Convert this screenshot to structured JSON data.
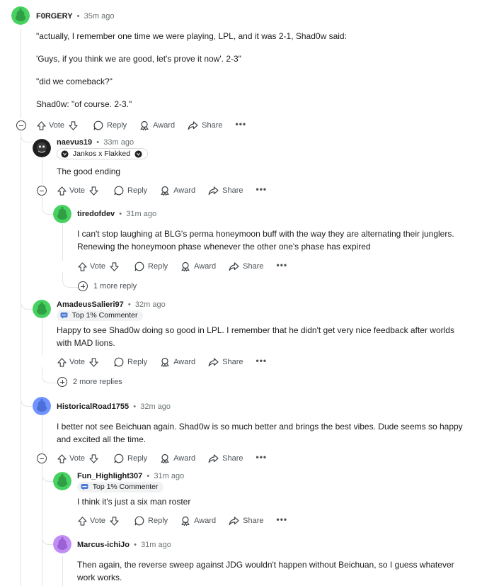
{
  "colors": {
    "avatar_green": "#46d160",
    "avatar_blue": "#7193ff",
    "avatar_purple": "#c18df5",
    "thread_line": "#e1e4e6",
    "meta_gray": "#6b7275"
  },
  "actions": {
    "vote": "Vote",
    "reply": "Reply",
    "award": "Award",
    "share": "Share",
    "more": "•••"
  },
  "comments": [
    {
      "user": "F0RGERY",
      "time": "35m ago",
      "avatar_color": "green",
      "paragraphs": [
        "\"actually, I remember one time we were playing, LPL, and it was 2-1, Shad0w said:",
        "'Guys, if you think we are good, let's prove it now'. 2-3\"",
        "\"did we comeback?\"",
        "Shad0w: \"of course. 2-3.\""
      ]
    },
    {
      "user": "naevus19",
      "time": "33m ago",
      "avatar_color": "dark",
      "flair": "Jankos x Flakked",
      "flair_icon": "team-logo-icon",
      "paragraphs": [
        "The good ending"
      ]
    },
    {
      "user": "tiredofdev",
      "time": "31m ago",
      "avatar_color": "green",
      "paragraphs": [
        "I can't stop laughing at BLG's perma honeymoon buff with the way they are alternating their junglers. Renewing the honeymoon phase whenever the other one's phase has expired"
      ],
      "more_replies": "1 more reply"
    },
    {
      "user": "AmadeusSalieri97",
      "time": "32m ago",
      "avatar_color": "green",
      "flair": "Top 1% Commenter",
      "flair_icon": "top-commenter-icon",
      "paragraphs": [
        "Happy to see Shad0w doing so good in LPL. I remember that he didn't get very nice feedback after worlds with MAD lions."
      ],
      "more_replies": "2 more replies"
    },
    {
      "user": "HistoricalRoad1755",
      "time": "32m ago",
      "avatar_color": "blue",
      "paragraphs": [
        "I better not see Beichuan again. Shad0w is so much better and brings the best vibes. Dude seems so happy and excited all the time."
      ]
    },
    {
      "user": "Fun_Highlight307",
      "time": "31m ago",
      "avatar_color": "green",
      "flair": "Top 1% Commenter",
      "flair_icon": "top-commenter-icon",
      "paragraphs": [
        "I think it's just a six man roster"
      ]
    },
    {
      "user": "Marcus-ichiJo",
      "time": "31m ago",
      "avatar_color": "purple",
      "paragraphs": [
        "Then again, the reverse sweep against JDG wouldn't happen without Beichuan, so I guess whatever work works."
      ]
    }
  ]
}
